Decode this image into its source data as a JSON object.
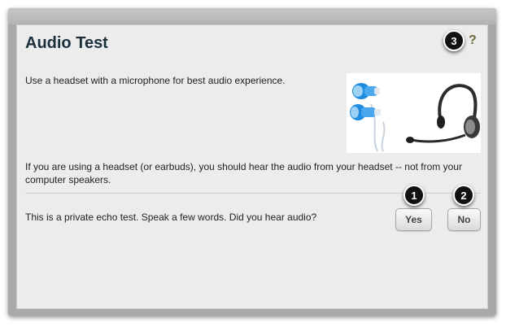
{
  "dialog": {
    "title": "Audio Test",
    "help_label": "?",
    "headset_text": "Use a headset with a microphone for best audio experience.",
    "earbuds_text": "If you are using a headset (or earbuds), you should hear the audio from your headset -- not from your computer speakers.",
    "echo_prompt": "This is a private echo test.  Speak a few words.  Did you hear audio?",
    "yes_label": "Yes",
    "no_label": "No"
  },
  "callouts": {
    "yes": "1",
    "no": "2",
    "help": "3"
  },
  "images": {
    "headset_illustration": "earbuds-and-headset-icon"
  }
}
